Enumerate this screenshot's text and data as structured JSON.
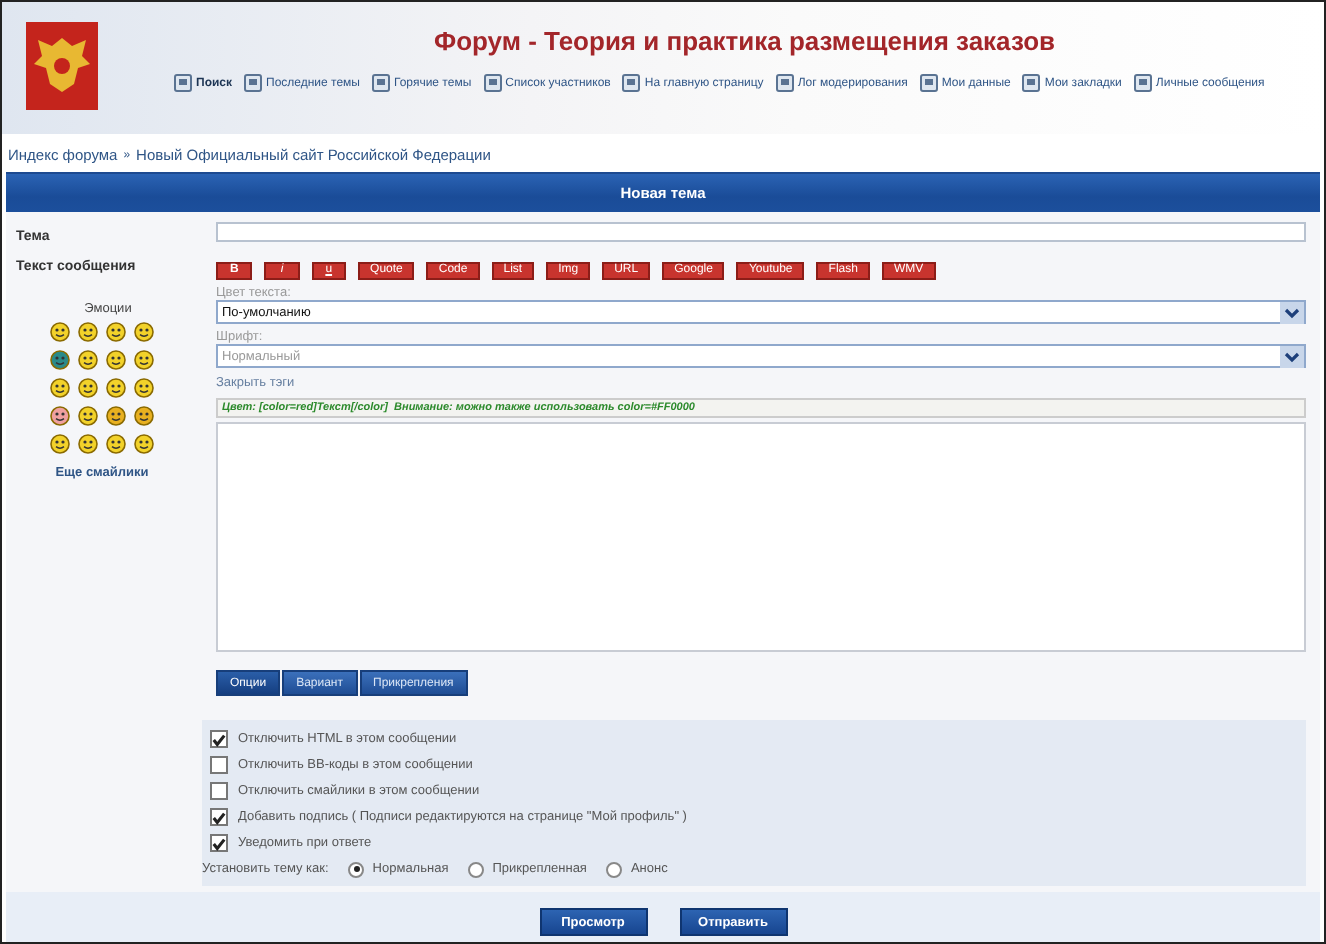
{
  "header": {
    "title": "Форум - Теория и практика размещения заказов",
    "nav": [
      {
        "label": "Поиск",
        "emphasized": true
      },
      {
        "label": "Последние темы",
        "emphasized": false
      },
      {
        "label": "Горячие темы",
        "emphasized": false
      },
      {
        "label": "Список участников",
        "emphasized": false
      },
      {
        "label": "На главную страницу",
        "emphasized": false
      },
      {
        "label": "Лог модерирования",
        "emphasized": false
      },
      {
        "label": "Мои данные",
        "emphasized": false
      },
      {
        "label": "Мои закладки",
        "emphasized": false
      },
      {
        "label": "Личные сообщения",
        "emphasized": false
      }
    ]
  },
  "breadcrumb": [
    {
      "label": "Индекс форума"
    },
    {
      "label": "Новый Официальный сайт Российской Федерации"
    }
  ],
  "breadcrumb_separator": "»",
  "panel_title": "Новая тема",
  "subject": {
    "label": "Тема"
  },
  "message": {
    "label": "Текст сообщения",
    "emoticons_label": "Эмоции",
    "more_smilies": "Еще смайлики",
    "toolbar": [
      {
        "label": "B",
        "kind": "bold"
      },
      {
        "label": "i",
        "kind": "italic"
      },
      {
        "label": "u",
        "kind": "underline"
      },
      {
        "label": "Quote",
        "kind": "plain"
      },
      {
        "label": "Code",
        "kind": "plain"
      },
      {
        "label": "List",
        "kind": "plain"
      },
      {
        "label": "Img",
        "kind": "plain"
      },
      {
        "label": "URL",
        "kind": "plain"
      },
      {
        "label": "Google",
        "kind": "plain"
      },
      {
        "label": "Youtube",
        "kind": "plain"
      },
      {
        "label": "Flash",
        "kind": "plain"
      },
      {
        "label": "WMV",
        "kind": "plain"
      }
    ],
    "selects": [
      {
        "label": "Цвет текста:",
        "value": "По-умолчанию",
        "disabled": false
      },
      {
        "label": "Шрифт:",
        "value": "Нормальный",
        "disabled": true
      }
    ],
    "close_tags": "Закрыть тэги",
    "help": "Цвет: [color=red]Текст[/color]  Внимание: можно также использовать color=#FF0000"
  },
  "tabs": [
    {
      "label": "Опции",
      "selected": true
    },
    {
      "label": "Вариант",
      "selected": false
    },
    {
      "label": "Прикрепления",
      "selected": false
    }
  ],
  "options": [
    {
      "label": "Отключить HTML в этом сообщении",
      "checked": true
    },
    {
      "label": "Отключить BB-коды в этом сообщении",
      "checked": false
    },
    {
      "label": "Отключить смайлики в этом сообщении",
      "checked": false
    },
    {
      "label": "Добавить подпись ( Подписи редактируются на странице \"Мой профиль\" )",
      "checked": true
    },
    {
      "label": "Уведомить при ответе",
      "checked": true
    }
  ],
  "topic_type": {
    "label": "Установить тему как:",
    "choices": [
      {
        "label": "Нормальная",
        "selected": true
      },
      {
        "label": "Прикрепленная",
        "selected": false
      },
      {
        "label": "Анонс",
        "selected": false
      }
    ]
  },
  "buttons": [
    {
      "label": "Просмотр"
    },
    {
      "label": "Отправить"
    }
  ]
}
